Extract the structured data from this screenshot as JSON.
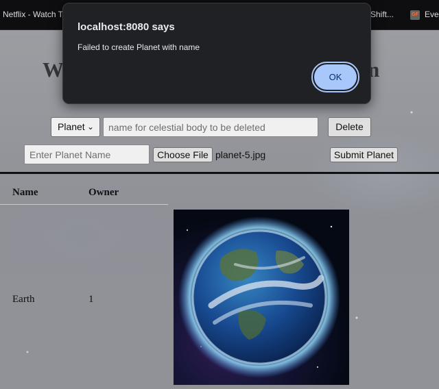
{
  "bookmarks": [
    {
      "label": "Netflix - Watch T"
    },
    {
      "label": "Shift..."
    },
    {
      "label": "Ever"
    }
  ],
  "page": {
    "heading_left": "W",
    "heading_right": "n",
    "delete_form": {
      "select_value": "Planet",
      "input_placeholder": "name for celestial body to be deleted",
      "delete_label": "Delete"
    },
    "submit_form": {
      "name_placeholder": "Enter Planet Name",
      "choose_file_label": "Choose File",
      "file_name": "planet-5.jpg",
      "submit_label": "Submit Planet"
    },
    "table": {
      "headers": [
        "Name",
        "Owner"
      ],
      "rows": [
        {
          "name": "Earth",
          "owner": "1",
          "image": "earth-planet-image"
        }
      ]
    }
  },
  "dialog": {
    "title": "localhost:8080 says",
    "message": "Failed to create Planet with name",
    "ok_label": "OK"
  },
  "colors": {
    "dialog_bg": "#202124",
    "ok_button": "#a8c7fa",
    "bookmarks_bg": "#0f0f12"
  }
}
